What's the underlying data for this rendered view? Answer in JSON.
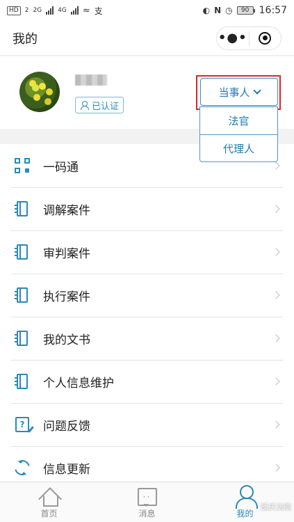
{
  "status_bar": {
    "left_chips": [
      "HD",
      "2"
    ],
    "network_1": "2G",
    "network_2": "4G",
    "carrier_glyph": "支",
    "battery": "90",
    "time": "16:57"
  },
  "header": {
    "title": "我的"
  },
  "profile": {
    "cert_label": "已认证"
  },
  "role": {
    "selected": "当事人",
    "options": [
      "法官",
      "代理人"
    ]
  },
  "menu": [
    {
      "label": "一码通",
      "icon": "qr-code-icon"
    },
    {
      "label": "调解案件",
      "icon": "notebook-icon"
    },
    {
      "label": "审判案件",
      "icon": "notebook-icon"
    },
    {
      "label": "执行案件",
      "icon": "notebook-icon"
    },
    {
      "label": "我的文书",
      "icon": "notebook-icon"
    },
    {
      "label": "个人信息维护",
      "icon": "notebook-icon"
    },
    {
      "label": "问题反馈",
      "icon": "feedback-icon"
    },
    {
      "label": "信息更新",
      "icon": "refresh-icon"
    }
  ],
  "tabbar": {
    "tabs": [
      {
        "label": "首页"
      },
      {
        "label": "消息"
      },
      {
        "label": "我的"
      }
    ],
    "active_color": "#2a89b8"
  },
  "watermark": "延庆法院"
}
